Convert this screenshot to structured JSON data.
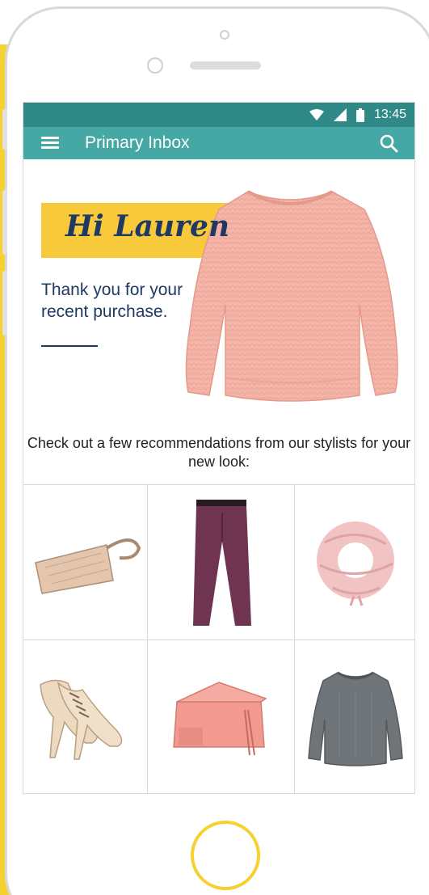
{
  "status_bar": {
    "time": "13:45",
    "icons": [
      "wifi-icon",
      "signal-icon",
      "battery-icon"
    ]
  },
  "app_bar": {
    "title": "Primary Inbox",
    "menu_icon": "menu-icon",
    "search_icon": "search-icon"
  },
  "hero": {
    "greeting": "Hi Lauren",
    "message": "Thank you for your recent purchase.",
    "image": "pink-sweater"
  },
  "recommendations": {
    "title": "Check out a few recommendations from our stylists for your new look:",
    "items": [
      {
        "image": "quilted-wallet"
      },
      {
        "image": "plum-trousers"
      },
      {
        "image": "pink-knit-scarf"
      },
      {
        "image": "cream-lace-up-heels"
      },
      {
        "image": "coral-clutch-bag"
      },
      {
        "image": "grey-sweater"
      }
    ]
  },
  "colors": {
    "status_bar": "#2f8a87",
    "app_bar": "#45a8a5",
    "banner": "#f8c93a",
    "page_background": "#f5d132",
    "heading_text": "#1e3a63"
  }
}
